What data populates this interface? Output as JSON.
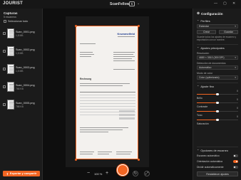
{
  "app": {
    "brand": "JOURIST",
    "title": "ScanFellow",
    "count": "5",
    "minimize": "—",
    "maximize": "▢",
    "close": "✕"
  },
  "left": {
    "title": "Capturas",
    "subtitle": "5 escaneos",
    "select_all": "Seleccionar todo",
    "items": [
      {
        "name": "Scan_0001.png",
        "size": "1,8 MB"
      },
      {
        "name": "Scan_0002.png",
        "size": "1,5 MB"
      },
      {
        "name": "Scan_0003.png",
        "size": "1,5 MB"
      },
      {
        "name": "Scan_0004.png",
        "size": "766 KB"
      },
      {
        "name": "Scan_0005.png",
        "size": "768 KB"
      }
    ],
    "export": "Exportar y compartir"
  },
  "center": {
    "document": {
      "logo": "Krummelfeld",
      "heading": "Rechnung"
    },
    "zoom": "100 %"
  },
  "right": {
    "title": "Configuración",
    "profiles": {
      "label": "Perfiles",
      "selected": "Estándar",
      "create": "Crear",
      "save": "Guardar",
      "hint": "Guarde todos los ajustes de escaneo y exportación con un nombre."
    },
    "main_settings": {
      "label": "Ajustes principales",
      "resolution_label": "Resolución",
      "resolution_value": "4680 × 3510 (300 DPI)",
      "detection_label": "Detección de documentos",
      "detection_value": "Automático",
      "color_label": "Modo de color",
      "color_value": "Color (optimizado)"
    },
    "fine_settings": {
      "label": "Ajuste fino",
      "sliders": [
        {
          "name": "Brillo",
          "value": "0",
          "pct": 0.5
        },
        {
          "name": "Contraste",
          "value": "0",
          "pct": 0.5
        },
        {
          "name": "Tono",
          "value": "0",
          "pct": 0.5
        },
        {
          "name": "Saturación",
          "value": "0",
          "pct": 0.5
        }
      ]
    },
    "scan_options": {
      "label": "Opciones de escaneo",
      "toggles": [
        {
          "name": "Escaneo automático",
          "on": false
        },
        {
          "name": "Orientación automática",
          "on": true
        },
        {
          "name": "Dividir automáticamente",
          "on": false
        }
      ]
    },
    "reset": "Restablecer ajustes"
  }
}
